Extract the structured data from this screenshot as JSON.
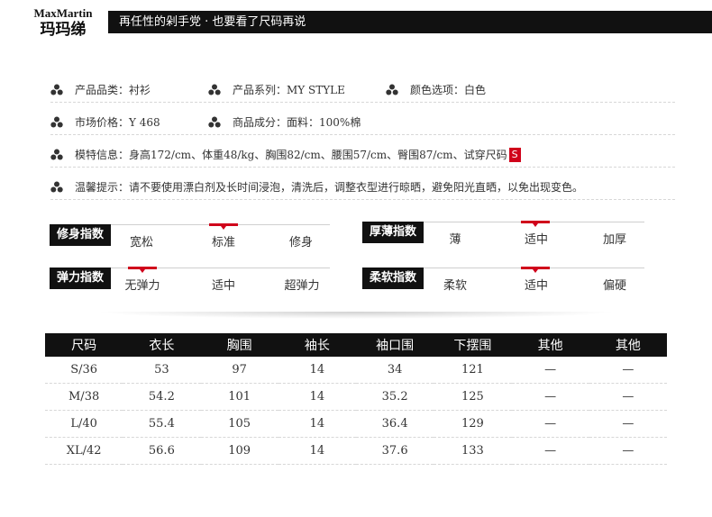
{
  "brand": {
    "name_en": "MaxMartin",
    "name_cn": "玛玛绨"
  },
  "header": {
    "slogan": "再任性的剁手党 · 也要看了尺码再说"
  },
  "info": {
    "category_label": "产品品类：",
    "category_value": "衬衫",
    "series_label": "产品系列：",
    "series_value": "MY STYLE",
    "color_label": "颜色选项：",
    "color_value": "白色",
    "price_label": "市场价格：",
    "price_value": "Y 468",
    "material_label": "商品成分：",
    "material_value": "面料：100%棉",
    "model_label": "模特信息：",
    "model_value": "身高172/cm、体重48/kg、胸围82/cm、腰围57/cm、臀围87/cm、试穿尺码",
    "model_size": "S",
    "tips_label": "温馨提示：",
    "tips_value": "请不要使用漂白剂及长时间浸泡，清洗后，调整衣型进行晾晒，避免阳光直晒，以免出现变色。"
  },
  "indices": [
    {
      "label": "修身指数",
      "options": [
        "宽松",
        "标准",
        "修身"
      ],
      "selected": "标准"
    },
    {
      "label": "厚薄指数",
      "options": [
        "薄",
        "适中",
        "加厚"
      ],
      "selected": "适中"
    },
    {
      "label": "弹力指数",
      "options": [
        "无弹力",
        "适中",
        "超弹力"
      ],
      "selected": "无弹力"
    },
    {
      "label": "柔软指数",
      "options": [
        "柔软",
        "适中",
        "偏硬"
      ],
      "selected": "适中"
    }
  ],
  "size_table": {
    "headers": [
      "尺码",
      "衣长",
      "胸围",
      "袖长",
      "袖口围",
      "下摆围",
      "其他",
      "其他"
    ],
    "rows": [
      [
        "S/36",
        "53",
        "97",
        "14",
        "34",
        "121",
        "—",
        "—"
      ],
      [
        "M/38",
        "54.2",
        "101",
        "14",
        "35.2",
        "125",
        "—",
        "—"
      ],
      [
        "L/40",
        "55.4",
        "105",
        "14",
        "36.4",
        "129",
        "—",
        "—"
      ],
      [
        "XL/42",
        "56.6",
        "109",
        "14",
        "37.6",
        "133",
        "—",
        "—"
      ]
    ]
  },
  "colors": {
    "accent": "#d0021b",
    "dark": "#111111"
  },
  "icons": {
    "bullet": "club-icon"
  }
}
